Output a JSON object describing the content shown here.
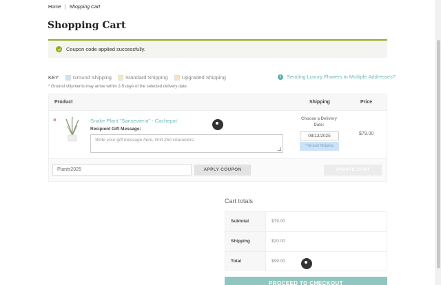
{
  "breadcrumb": {
    "home": "Home",
    "separator": "|",
    "current": "Shopping Cart"
  },
  "page_title": "Shopping Cart",
  "notice": {
    "text": "Coupon code applied successfully.",
    "icon": "check-circle-icon",
    "color": "#8fae1b"
  },
  "key": {
    "label": "KEY:",
    "items": [
      {
        "label": "Ground Shipping",
        "color": "#cde3f5"
      },
      {
        "label": "Standard Shipping",
        "color": "#f2ecc0"
      },
      {
        "label": "Upgraded Shipping",
        "color": "#f6e3c3"
      }
    ]
  },
  "multi_address_link": "Sending Luxury Flowers to Multiple Addresses?",
  "ground_note": "* Ground shipments may arrive within 2-5 days of the selected delivery date.",
  "cart_headers": {
    "product": "Product",
    "shipping": "Shipping",
    "price": "Price"
  },
  "cart_item": {
    "remove": "×",
    "name": "Snake Plant \"Sansevieria\" - Cachepot",
    "gift_label": "Recipient Gift Message:",
    "gift_placeholder": "Write your gift message here, limit 250 characters.",
    "delivery_label": "Choose a Delivery Date:",
    "delivery_date": "08/13/2025",
    "shipping_badge": "* Ground Shipping",
    "price": "$79.00"
  },
  "coupon": {
    "value": "Plants2025",
    "apply_label": "APPLY COUPON",
    "update_label": "UPDATE CART"
  },
  "totals": {
    "title": "Cart totals",
    "rows": [
      {
        "label": "Subtotal",
        "value": "$79.00"
      },
      {
        "label": "Shipping",
        "value": "$20.00"
      },
      {
        "label": "Total",
        "value": "$99.00"
      }
    ]
  },
  "checkout_label": "PROCEED TO CHECKOUT",
  "colors": {
    "accent": "#6cb7b7",
    "checkout": "#8fc6bf",
    "remove": "#d9534f"
  }
}
